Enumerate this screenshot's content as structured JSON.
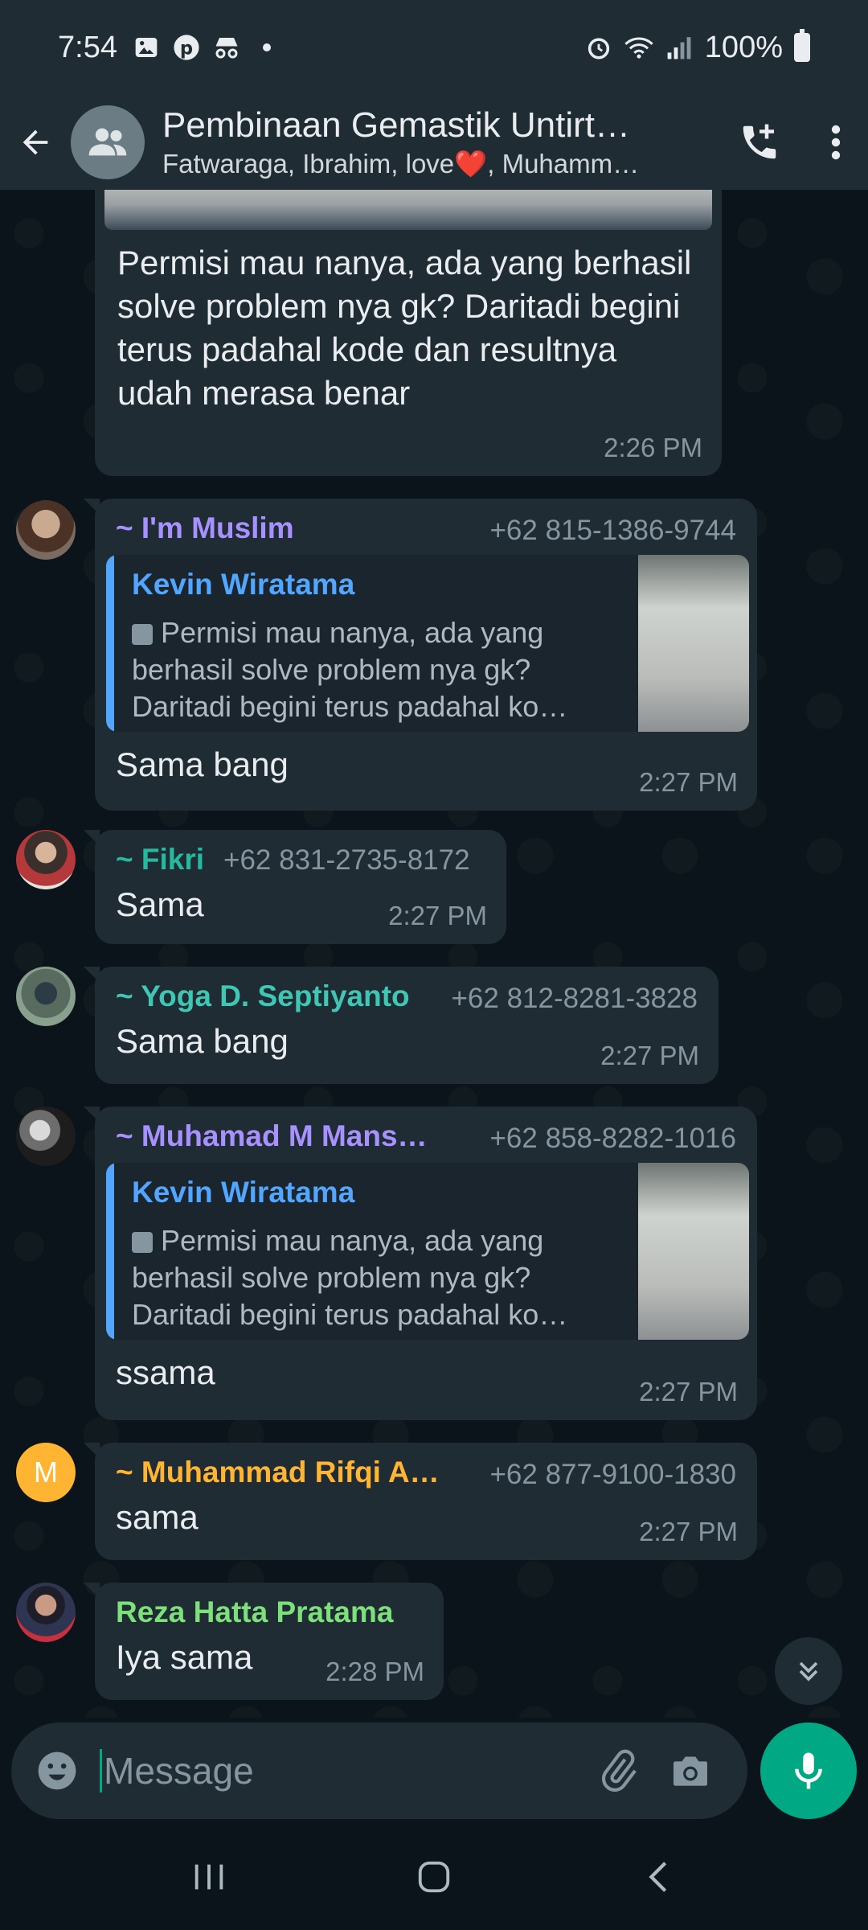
{
  "status_bar": {
    "time": "7:54",
    "battery": "100%"
  },
  "header": {
    "title": "Pembinaan Gemastik Untirt…",
    "subtitle": "Fatwaraga, Ibrahim, love❤️, Muhamm…"
  },
  "messages": [
    {
      "text": "Permisi mau nanya, ada yang berhasil solve problem nya gk? Daritadi begini terus padahal kode dan resultnya udah merasa benar",
      "time": "2:26 PM"
    },
    {
      "sender": "~ I'm Muslim",
      "sender_color": "#a791ff",
      "phone": "+62 815-1386-9744",
      "quote_name": "Kevin Wiratama",
      "quote_text": "Permisi mau nanya, ada yang berhasil solve problem nya gk? Daritadi begini terus padahal ko…",
      "text": "Sama bang",
      "time": "2:27 PM"
    },
    {
      "sender": "~ Fikri",
      "sender_color": "#25b9a0",
      "phone": "+62 831-2735-8172",
      "text": "Sama",
      "time": "2:27 PM"
    },
    {
      "sender": "~ Yoga D. Septiyanto",
      "sender_color": "#3fc6b4",
      "phone": "+62 812-8281-3828",
      "text": "Sama bang",
      "time": "2:27 PM"
    },
    {
      "sender": "~ Muhamad M Mans…",
      "sender_color": "#a791ff",
      "phone": "+62 858-8282-1016",
      "quote_name": "Kevin Wiratama",
      "quote_text": "Permisi mau nanya, ada yang berhasil solve problem nya gk? Daritadi begini terus padahal ko…",
      "text": "ssama",
      "time": "2:27 PM"
    },
    {
      "sender": "~ Muhammad Rifqi A…",
      "sender_color": "#ffb432",
      "phone": "+62 877-9100-1830",
      "avatar_letter": "M",
      "text": "sama",
      "time": "2:27 PM"
    },
    {
      "sender": "Reza Hatta Pratama",
      "sender_color": "#7ee07a",
      "text": "Iya sama",
      "time": "2:28 PM"
    }
  ],
  "input": {
    "placeholder": "Message"
  }
}
